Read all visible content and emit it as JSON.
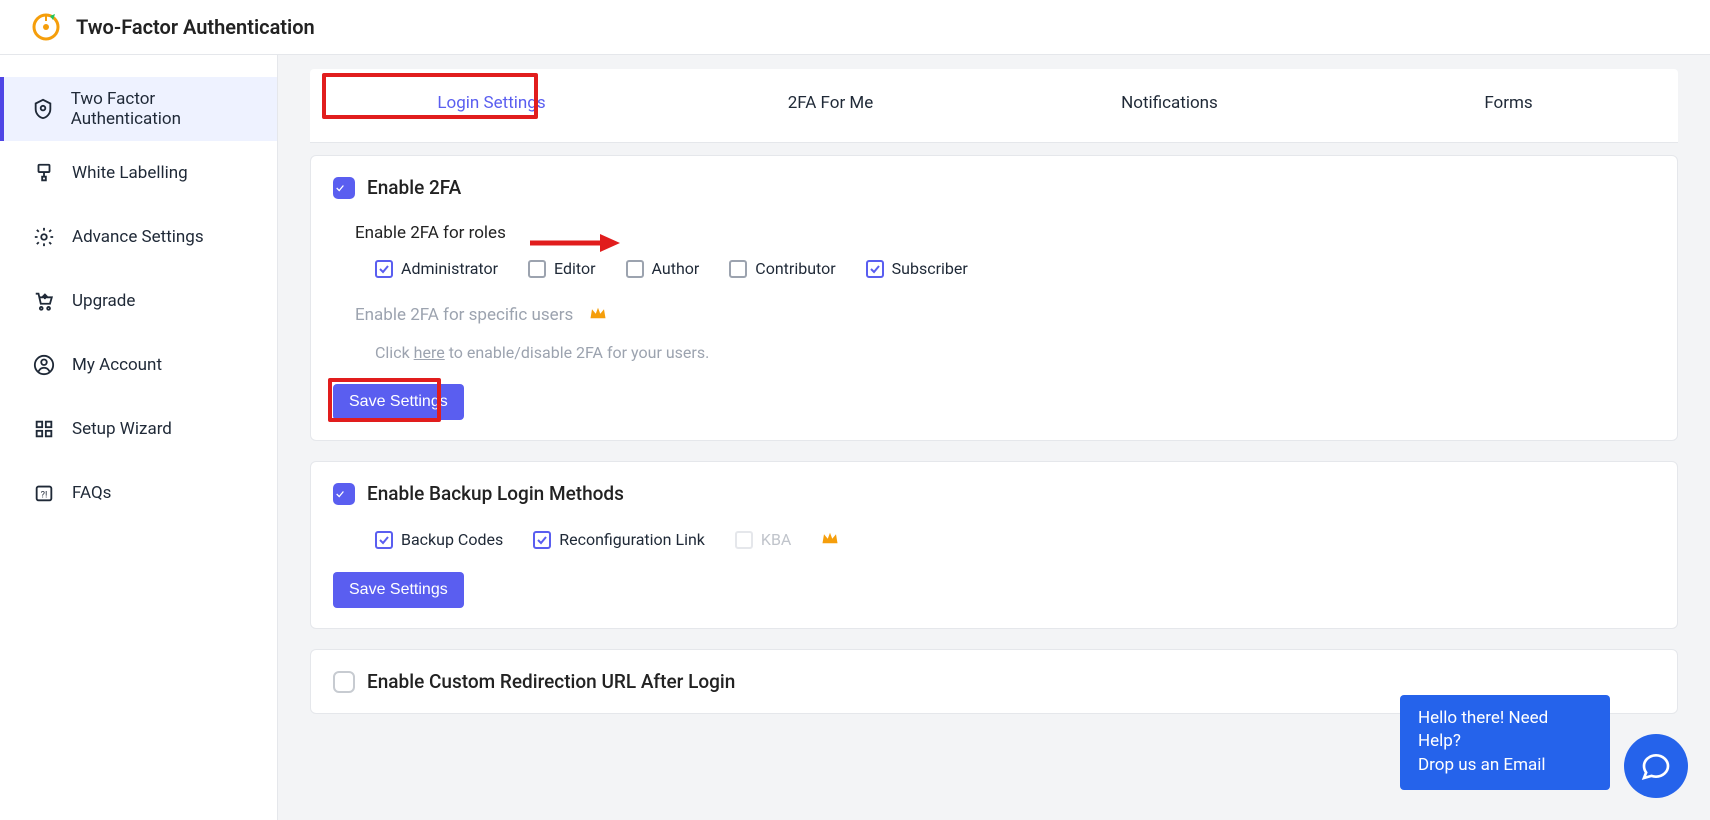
{
  "header": {
    "title": "Two-Factor Authentication"
  },
  "sidebar": {
    "items": [
      {
        "label": "Two Factor Authentication"
      },
      {
        "label": "White Labelling"
      },
      {
        "label": "Advance Settings"
      },
      {
        "label": "Upgrade"
      },
      {
        "label": "My Account"
      },
      {
        "label": "Setup Wizard"
      },
      {
        "label": "FAQs"
      }
    ]
  },
  "tabs": {
    "login_settings": "Login Settings",
    "for_me": "2FA For Me",
    "notifications": "Notifications",
    "forms": "Forms"
  },
  "card1": {
    "enable_label": "Enable 2FA",
    "roles_title": "Enable 2FA for roles",
    "roles": {
      "administrator": "Administrator",
      "editor": "Editor",
      "author": "Author",
      "contributor": "Contributor",
      "subscriber": "Subscriber"
    },
    "specific_users": "Enable 2FA for specific users",
    "specific_help_pre": "Click ",
    "specific_help_link": "here",
    "specific_help_post": " to enable/disable 2FA for your users.",
    "save": "Save Settings"
  },
  "card2": {
    "enable_label": "Enable Backup Login Methods",
    "backup_codes": "Backup Codes",
    "reconfig": "Reconfiguration Link",
    "kba": "KBA",
    "save": "Save Settings"
  },
  "card3": {
    "enable_label": "Enable Custom Redirection URL After Login"
  },
  "help": {
    "line1": "Hello there! Need Help?",
    "line2": "Drop us an Email"
  }
}
